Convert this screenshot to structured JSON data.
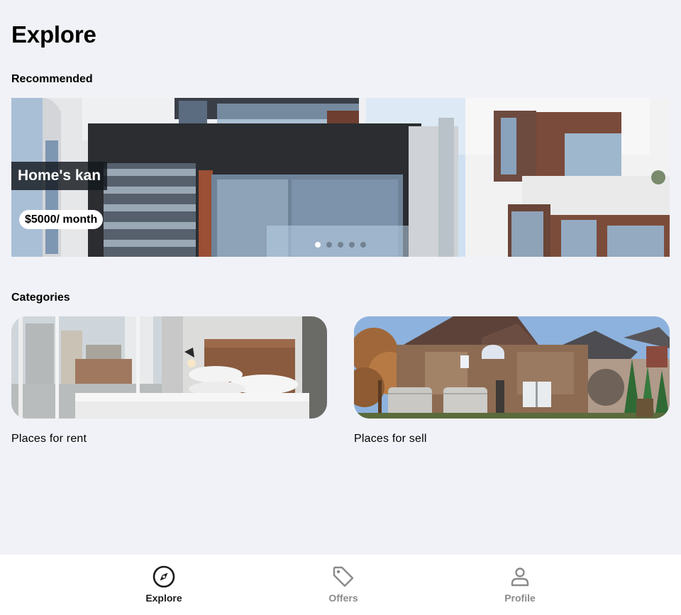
{
  "page": {
    "title": "Explore"
  },
  "recommended": {
    "heading": "Recommended",
    "slide": {
      "name": "Home's kan",
      "price": "$5000/ month"
    },
    "pagination": {
      "count": 5,
      "active_index": 0
    }
  },
  "categories": {
    "heading": "Categories",
    "items": [
      {
        "label": "Places for rent"
      },
      {
        "label": "Places for sell"
      }
    ]
  },
  "tabbar": {
    "tabs": [
      {
        "label": "Explore",
        "icon": "compass-icon",
        "active": true
      },
      {
        "label": "Offers",
        "icon": "tag-icon",
        "active": false
      },
      {
        "label": "Profile",
        "icon": "person-icon",
        "active": false
      }
    ]
  },
  "colors": {
    "background": "#f1f2f7",
    "active_tab": "#1a1a1a",
    "inactive_tab": "#8a8a8a"
  }
}
